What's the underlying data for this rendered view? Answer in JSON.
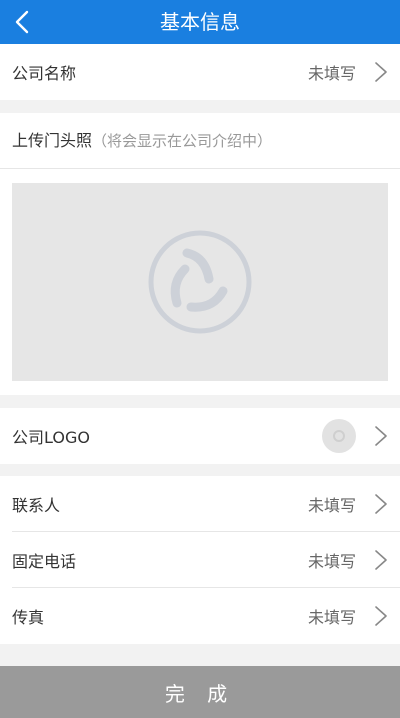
{
  "header": {
    "title": "基本信息",
    "back_icon": "chevron-left-icon"
  },
  "company_name": {
    "label": "公司名称",
    "value": "未填写"
  },
  "storefront": {
    "label": "上传门头照",
    "hint": "（将会显示在公司介绍中）",
    "placeholder_icon": "app-logo-icon"
  },
  "company_logo": {
    "label": "公司LOGO",
    "thumb_icon": "image-placeholder-icon"
  },
  "contact": {
    "items": [
      {
        "label": "联系人",
        "value": "未填写"
      },
      {
        "label": "固定电话",
        "value": "未填写"
      },
      {
        "label": "传真",
        "value": "未填写"
      }
    ]
  },
  "footer": {
    "submit_label": "完 成"
  },
  "colors": {
    "nav": "#1a7fe0",
    "background": "#f2f2f2",
    "placeholder_box": "#e6e6e6",
    "button_disabled": "#9a9a9a"
  }
}
